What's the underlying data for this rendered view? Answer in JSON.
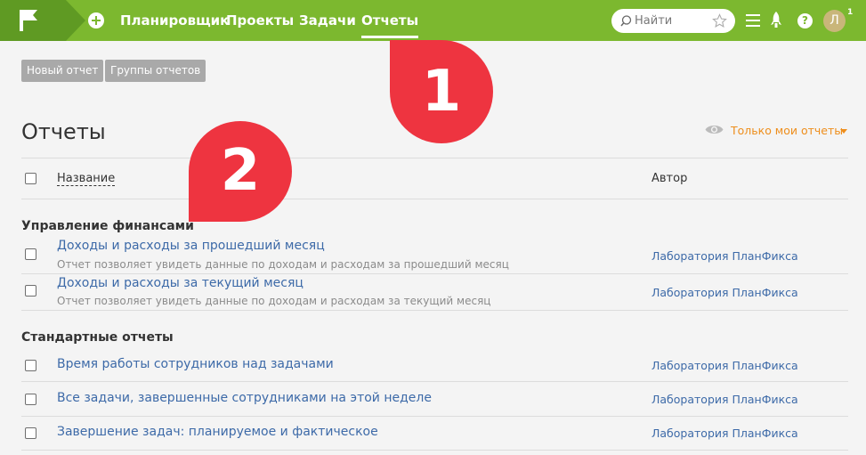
{
  "nav": {
    "items": [
      "Планировщик",
      "Проекты",
      "Задачи",
      "Отчеты"
    ],
    "active": "Отчеты"
  },
  "search": {
    "placeholder": "Найти"
  },
  "user": {
    "initial": "Л",
    "notifications": "1"
  },
  "toolbar": {
    "new_report": "Новый отчет",
    "report_groups": "Группы отчетов"
  },
  "page": {
    "title": "Отчеты",
    "filter": "Только мои отчеты"
  },
  "table": {
    "col_name": "Название",
    "col_author": "Автор"
  },
  "groups": [
    {
      "title": "Управление финансами",
      "reports": [
        {
          "name": "Доходы и расходы за прошедший месяц",
          "description": "Отчет позволяет увидеть данные по доходам и расходам за прошедший месяц",
          "author": "Лаборатория ПланФикса"
        },
        {
          "name": "Доходы и расходы за текущий месяц",
          "description": "Отчет позволяет увидеть данные по доходам и расходам за текущий месяц",
          "author": "Лаборатория ПланФикса"
        }
      ]
    },
    {
      "title": "Стандартные отчеты",
      "reports": [
        {
          "name": "Время работы сотрудников над задачами",
          "author": "Лаборатория ПланФикса"
        },
        {
          "name": "Все задачи, завершенные сотрудниками на этой неделе",
          "author": "Лаборатория ПланФикса"
        },
        {
          "name": "Завершение задач: планируемое и фактическое",
          "author": "Лаборатория ПланФикса"
        }
      ]
    }
  ],
  "callouts": [
    "1",
    "2"
  ],
  "colors": {
    "topbar": "#7cb82f",
    "logo": "#5f9a23",
    "link": "#3d6aa8",
    "filter": "#ee8e1c",
    "callout": "#ee3440"
  },
  "icons": [
    "flag-logo-icon",
    "plus-icon",
    "search-icon",
    "star-icon",
    "menu-icon",
    "rocket-icon",
    "help-icon",
    "eye-icon",
    "caret-down-icon"
  ]
}
